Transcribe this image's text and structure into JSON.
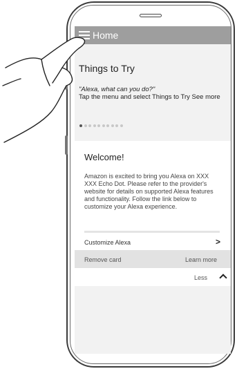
{
  "app": {
    "title": "Home"
  },
  "things_to_try": {
    "title": "Things to Try",
    "quote": "\"Alexa, what can you do?\"",
    "hint": "Tap the menu and select Things to Try See more",
    "page_count": 10,
    "active_page": 0
  },
  "card": {
    "title": "Welcome!",
    "body": "Amazon is excited to bring you Alexa on XXX XXX Echo Dot. Please refer to the provider's website for details on supported Alexa features and functionality. Follow the link below to customize your Alexa experience.",
    "customize_label": "Customize Alexa",
    "remove_label": "Remove card",
    "learn_more_label": "Learn more",
    "less_label": "Less"
  },
  "colors": {
    "appbar": "#9e9e9e",
    "screen_bg": "#f2f2f2",
    "action_row": "#e2e2e2"
  }
}
